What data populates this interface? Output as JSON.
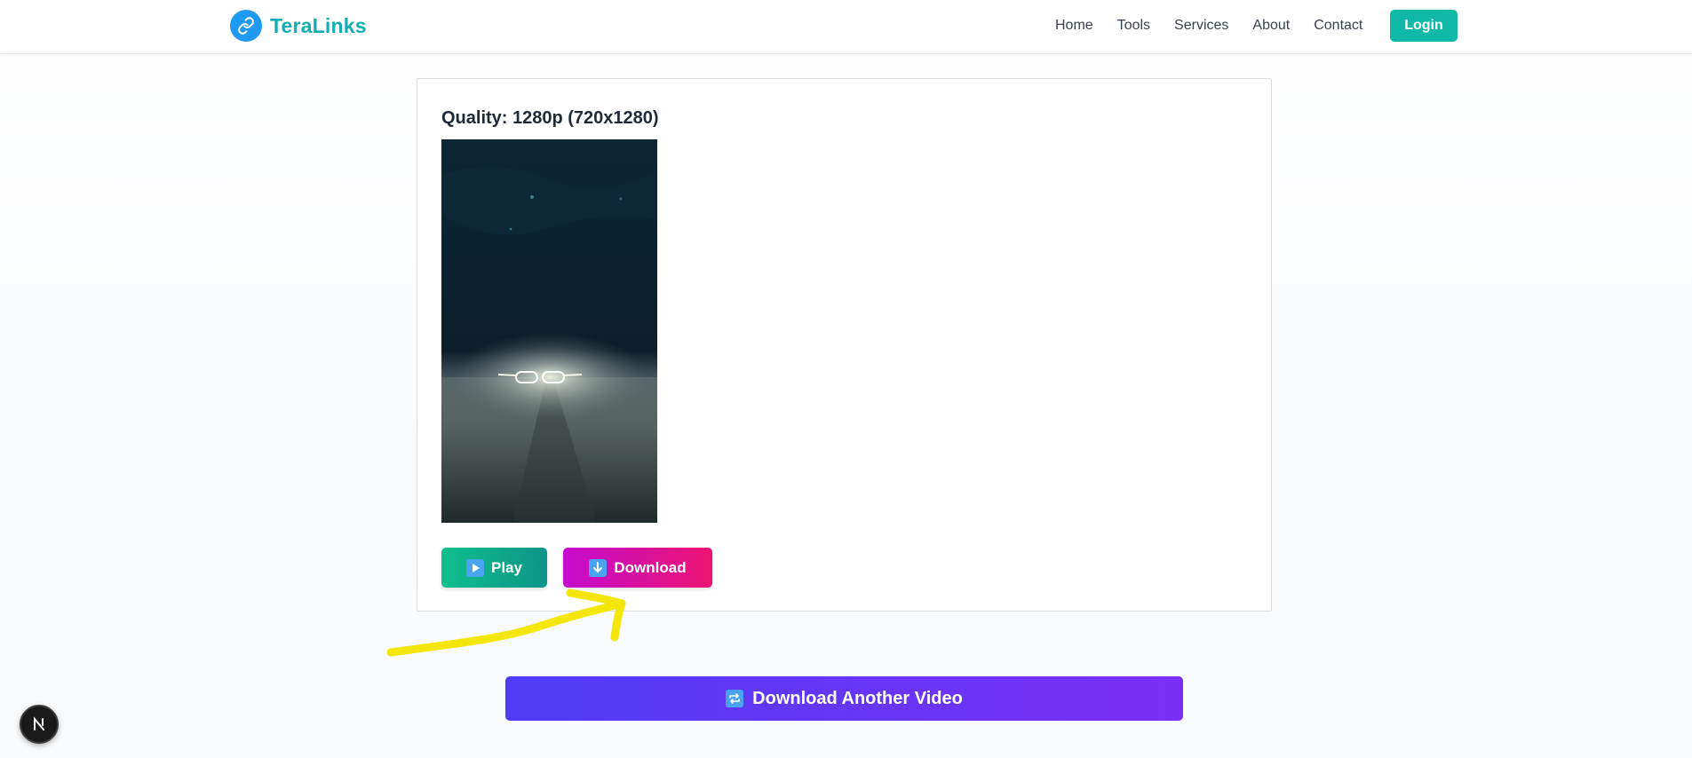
{
  "brand": {
    "name": "TeraLinks",
    "icon": "link-icon",
    "accent": "#13aeb3"
  },
  "nav": {
    "links": [
      "Home",
      "Tools",
      "Services",
      "About",
      "Contact"
    ],
    "login_label": "Login",
    "login_color": "#10b9a5"
  },
  "result": {
    "quality_label": "Quality: 1280p (720x1280)",
    "thumbnail_icon": "video-thumbnail-car-headlights",
    "play_label": "Play",
    "play_icon": "play-emoji-icon",
    "download_label": "Download",
    "download_icon": "down-arrow-emoji-icon"
  },
  "footer": {
    "another_label": "Download Another Video",
    "another_icon": "repeat-emoji-icon"
  },
  "badge": {
    "letter": "N",
    "icon": "nextjs-icon"
  }
}
